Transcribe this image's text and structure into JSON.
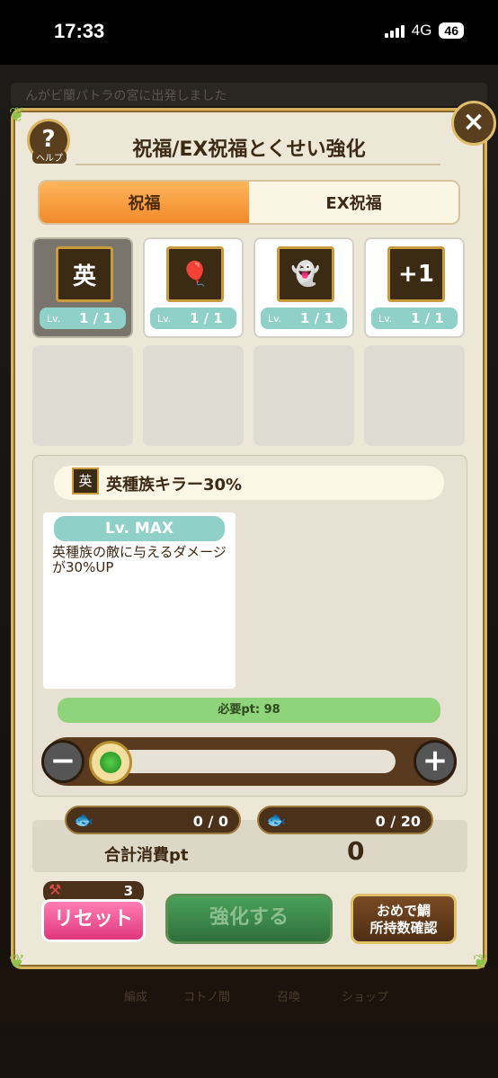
{
  "status_bar": {
    "time": "17:33",
    "network": "4G",
    "battery": "46"
  },
  "background": {
    "notice": "んがビ蘭パトラの宮に出発しました",
    "nav_items": [
      "編成",
      "コトノ間",
      "召喚",
      "ショップ"
    ]
  },
  "dialog": {
    "help_label": "ヘルプ",
    "help_symbol": "?",
    "title": "祝福/EX祝福とくせい強化",
    "close_symbol": "×",
    "tabs": [
      {
        "label": "祝福",
        "active": true
      },
      {
        "label": "EX祝福",
        "active": false
      }
    ],
    "skills": [
      {
        "icon": "hero-killer-check-icon",
        "icon_text": "英",
        "lv_label": "Lv.",
        "lv_value": "1 / 1",
        "selected": true
      },
      {
        "icon": "balloon-icon",
        "icon_text": "🎈",
        "lv_label": "Lv.",
        "lv_value": "1 / 1",
        "selected": false
      },
      {
        "icon": "ghost-shield-icon",
        "icon_text": "👻",
        "lv_label": "Lv.",
        "lv_value": "1 / 1",
        "selected": false
      },
      {
        "icon": "combo-plus-icon",
        "icon_text": "+1",
        "lv_label": "Lv.",
        "lv_value": "1 / 1",
        "selected": false
      }
    ],
    "detail": {
      "skill_icon_text": "英",
      "skill_name": "英種族キラー30%",
      "level_label": "Lv. MAX",
      "description": "英種族の敵に与えるダメージが30%UP",
      "required_pt": "必要pt: 98"
    },
    "slider": {
      "minus": "−",
      "plus": "+",
      "value": 0
    },
    "costs": [
      {
        "icon": "red-fish-icon",
        "value": "0 / 0"
      },
      {
        "icon": "gold-fish-icon",
        "value": "0 / 20"
      }
    ],
    "total_label": "合計消費pt",
    "total_value": "0",
    "reset_count": "3",
    "buttons": {
      "reset": "リセット",
      "enhance": "強化する",
      "confirm_line1": "おめで鯛",
      "confirm_line2": "所持数確認"
    }
  },
  "colors": {
    "tab_active": "#f08a2a",
    "level_badge": "#8fd0c8",
    "required_bar": "#8fd37a",
    "reset_button": "#e0377c",
    "enhance_button": "#2f6f3a"
  }
}
